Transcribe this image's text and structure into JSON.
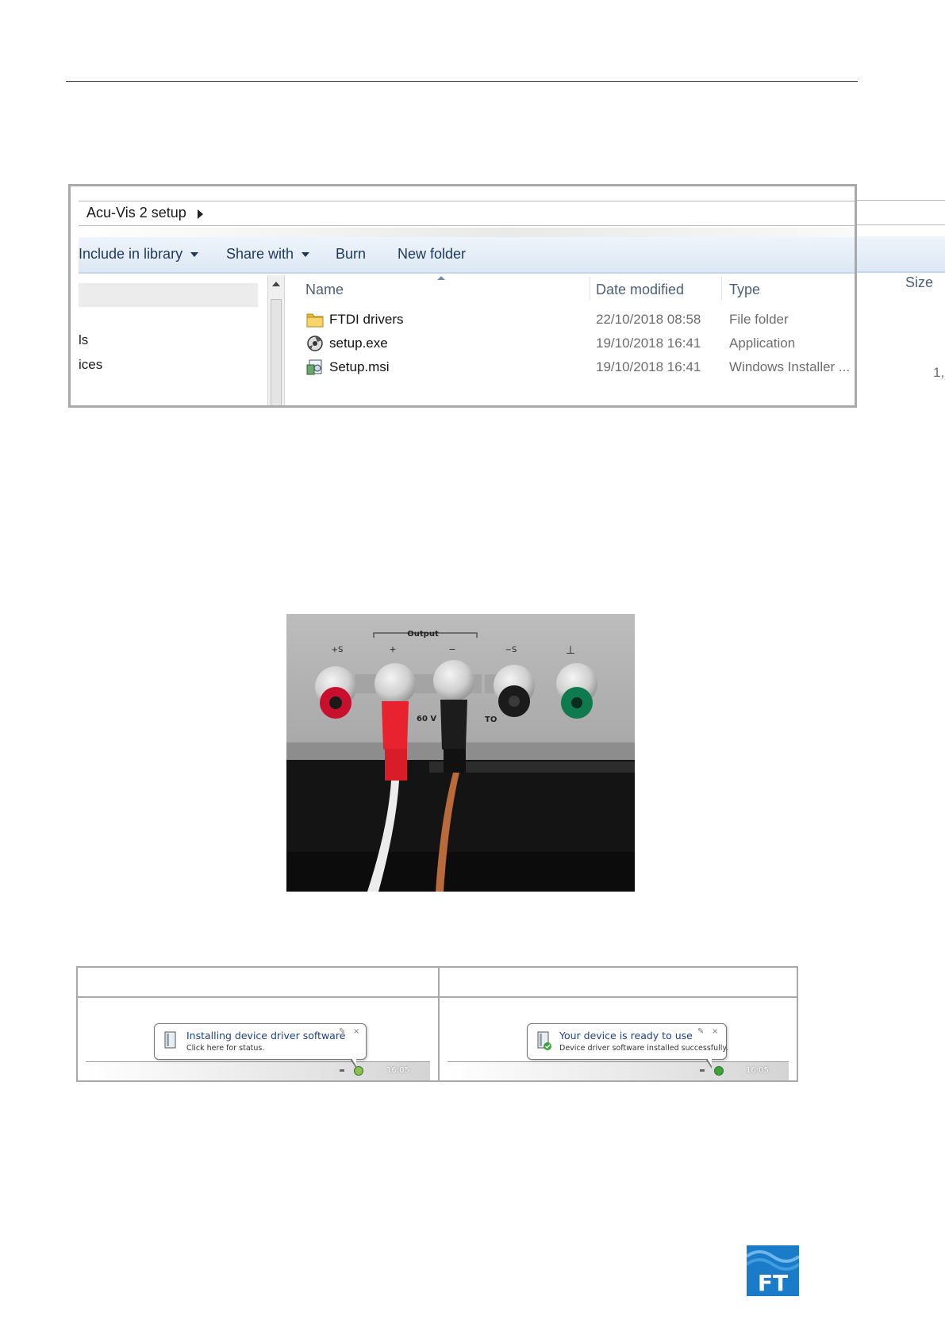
{
  "explorer": {
    "breadcrumb": "Acu-Vis 2 setup",
    "toolbar": {
      "include_in_library": "Include in library",
      "share_with": "Share with",
      "burn": "Burn",
      "new_folder": "New folder"
    },
    "nav_items": [
      "ls",
      "ices"
    ],
    "columns": {
      "name": "Name",
      "date_modified": "Date modified",
      "type": "Type",
      "size": "Size"
    },
    "files": [
      {
        "name": "FTDI drivers",
        "date": "22/10/2018 08:58",
        "type": "File folder",
        "size": "",
        "icon": "folder-icon"
      },
      {
        "name": "setup.exe",
        "date": "19/10/2018 16:41",
        "type": "Application",
        "size": "",
        "icon": "setup-exe-icon"
      },
      {
        "name": "Setup.msi",
        "date": "19/10/2018 16:41",
        "type": "Windows Installer ...",
        "size": "1,",
        "icon": "installer-icon"
      }
    ]
  },
  "photo": {
    "panel_label": "Output",
    "terminals": [
      "+S",
      "+",
      "−",
      "−S",
      "⊥"
    ],
    "lower_text_1": "60 V",
    "lower_text_2": "TO"
  },
  "notifications": {
    "installing": {
      "title": "Installing device driver software",
      "subtitle": "Click here for status.",
      "clock": "16:05"
    },
    "ready": {
      "title": "Your device is ready to use",
      "subtitle": "Device driver software installed successfully.",
      "clock": "16:05"
    }
  },
  "logo": {
    "text": "FT",
    "color": "#1a7cc9"
  }
}
